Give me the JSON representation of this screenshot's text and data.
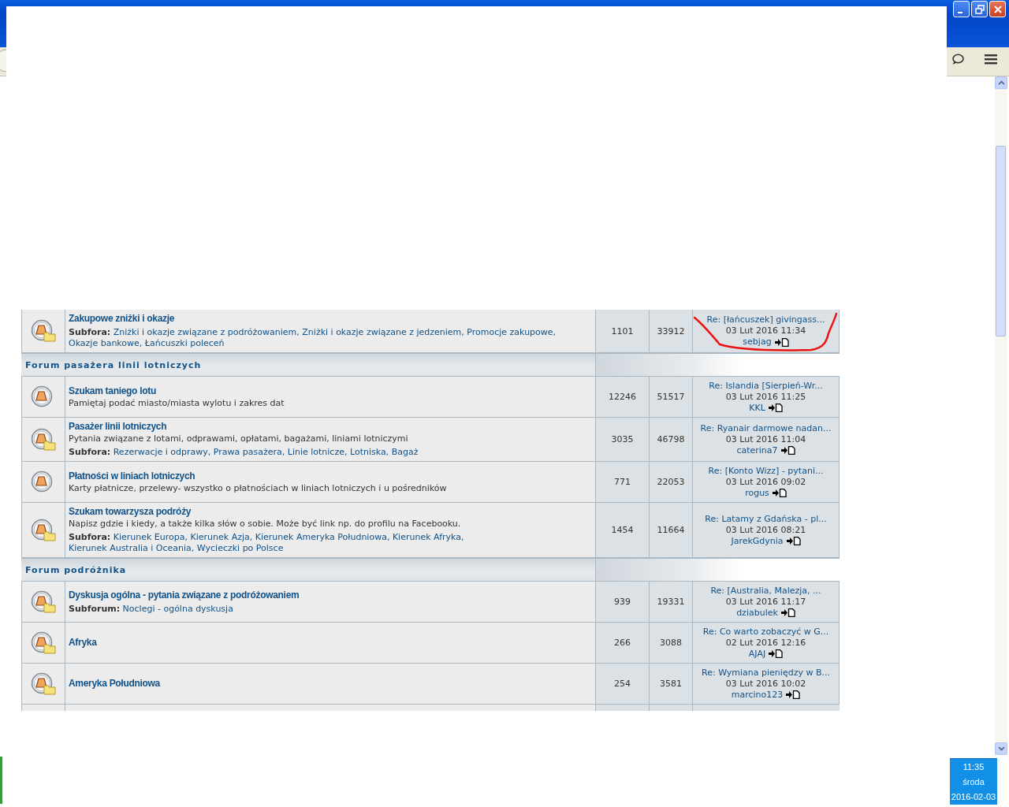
{
  "clock": {
    "time": "11:35",
    "day": "środa",
    "date": "2016-02-03"
  },
  "forum_rows": [
    {
      "kind": "forumfolder",
      "title": "Zakupowe zniżki i okazje",
      "subforum_label": "Subfora:",
      "subforums": [
        "Zniżki i okazje związane z podróżowaniem,",
        "Zniżki i okazje związane z jedzeniem,",
        "Promocje zakupowe,",
        "Okazje bankowe,",
        "Łańcuszki poleceń"
      ],
      "topics": "1101",
      "posts": "33912",
      "last_post": {
        "title": "Re: [łańcuszek] givingass...",
        "date": "03 Lut 2016 11:34",
        "author": "sebjag"
      },
      "annotation": {
        "kind": "stroke"
      }
    },
    {
      "kind": "category",
      "title": "Forum pasażera linii lotniczych"
    },
    {
      "kind": "forum",
      "title": "Szukam taniego lotu",
      "description": "Pamiętaj podać miasto/miasta wylotu i zakres dat",
      "topics": "12246",
      "posts": "51517",
      "last_post": {
        "title": "Re: Islandia [Sierpień-Wr...",
        "date": "03 Lut 2016 11:25",
        "author": "KKL"
      }
    },
    {
      "kind": "forumfolder",
      "title": "Pasażer linii lotniczych",
      "description": "Pytania związane z lotami, odprawami, opłatami, bagażami, liniami lotniczymi",
      "subforum_label": "Subfora:",
      "subforums": [
        "Rezerwacje i odprawy,",
        "Prawa pasażera,",
        "Linie lotnicze,",
        "Lotniska,",
        "Bagaż"
      ],
      "topics": "3035",
      "posts": "46798",
      "last_post": {
        "title": "Re: Ryanair darmowe nadan...",
        "date": "03 Lut 2016 11:04",
        "author": "caterina7"
      }
    },
    {
      "kind": "forum",
      "title": "Płatności w liniach lotniczych",
      "description": "Karty płatnicze, przelewy- wszystko o płatnościach w liniach lotniczych i u pośredników",
      "topics": "771",
      "posts": "22053",
      "last_post": {
        "title": "Re: [Konto Wizz] - pytani...",
        "date": "03 Lut 2016 09:02",
        "author": "rogus"
      }
    },
    {
      "kind": "forumfolder",
      "title": "Szukam towarzysza podróży",
      "description": "Napisz gdzie i kiedy, a także kilka słów o sobie. Może być link np. do profilu na Facebooku.",
      "subforum_label": "Subfora:",
      "subforums": [
        "Kierunek Europa,",
        "Kierunek Azja,",
        "Kierunek Ameryka Południowa,",
        "Kierunek Afryka,",
        "Kierunek Australia i Oceania,",
        "Wycieczki po Polsce"
      ],
      "topics": "1454",
      "posts": "11664",
      "last_post": {
        "title": "Re: Latamy z Gdańska - pl...",
        "date": "03 Lut 2016 08:21",
        "author": "JarekGdynia"
      }
    },
    {
      "kind": "category",
      "title": "Forum podróżnika"
    },
    {
      "kind": "forumfolder",
      "title": "Dyskusja ogólna - pytania związane z podróżowaniem",
      "subforum_label": "Subforum:",
      "subforums": [
        "Noclegi - ogólna dyskusja"
      ],
      "topics": "939",
      "posts": "19331",
      "last_post": {
        "title": "Re: [Australia, Malezja, ...",
        "date": "03 Lut 2016 11:17",
        "author": "dziabulek"
      }
    },
    {
      "kind": "forumfolder",
      "title": "Afryka",
      "topics": "266",
      "posts": "3088",
      "last_post": {
        "title": "Re: Co warto zobaczyć w G...",
        "date": "02 Lut 2016 12:16",
        "author": "AJAJ"
      }
    },
    {
      "kind": "forumfolder",
      "title": "Ameryka Południowa",
      "topics": "254",
      "posts": "3581",
      "last_post": {
        "title": "Re: Wymiana pieniędzy w B...",
        "date": "03 Lut 2016 10:02",
        "author": "marcino123"
      }
    }
  ]
}
